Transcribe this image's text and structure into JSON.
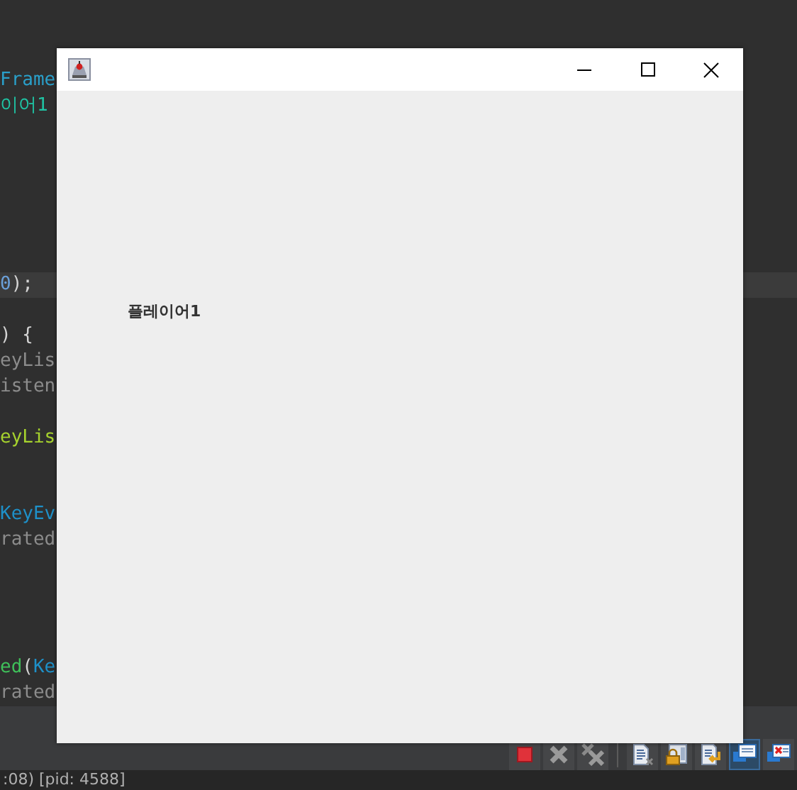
{
  "editor": {
    "lines": [
      {
        "highlighted": false,
        "segments": [
          {
            "text": "Frame",
            "color": "#2a9fc9"
          }
        ]
      },
      {
        "highlighted": false,
        "segments": [
          {
            "text": "이어1",
            "color": "#1fc4a4"
          }
        ]
      },
      {
        "highlighted": true,
        "segments": [
          {
            "text": "0",
            "color": "#6a9fd8"
          },
          {
            "text": ");",
            "color": "#d4d4d4"
          }
        ]
      },
      {
        "highlighted": false,
        "segments": [
          {
            "text": ") {",
            "color": "#d4d4d4"
          }
        ]
      },
      {
        "highlighted": false,
        "segments": [
          {
            "text": "eyLis",
            "color": "#8c8c8c"
          }
        ]
      },
      {
        "highlighted": false,
        "segments": [
          {
            "text": "isten",
            "color": "#8c8c8c"
          }
        ]
      },
      {
        "highlighted": false,
        "segments": [
          {
            "text": "eyLis",
            "color": "#a6d22e"
          }
        ]
      },
      {
        "highlighted": false,
        "segments": [
          {
            "text": "KeyEv",
            "color": "#1e90c8"
          }
        ]
      },
      {
        "highlighted": false,
        "segments": [
          {
            "text": "rated",
            "color": "#8c8c8c"
          }
        ]
      },
      {
        "highlighted": false,
        "segments": [
          {
            "text": "ed",
            "color": "#3fc15a"
          },
          {
            "text": "(",
            "color": "#d4d4d4"
          },
          {
            "text": "Ke",
            "color": "#1e90c8"
          }
        ]
      },
      {
        "highlighted": false,
        "segments": [
          {
            "text": "rated",
            "color": "#8c8c8c"
          }
        ]
      }
    ]
  },
  "window": {
    "label": "플레이어1"
  },
  "toolbar": {
    "buttons": [
      {
        "kind": "stop",
        "selected": false
      },
      {
        "kind": "remove",
        "selected": false
      },
      {
        "kind": "remove-all",
        "selected": false
      },
      {
        "kind": "doc-x",
        "selected": false
      },
      {
        "kind": "lock",
        "selected": false
      },
      {
        "kind": "doc-arrow",
        "selected": false
      },
      {
        "kind": "console",
        "selected": true
      },
      {
        "kind": "console-x",
        "selected": false
      }
    ]
  },
  "status_bar": {
    "text": ":08) [pid: 4588]"
  }
}
